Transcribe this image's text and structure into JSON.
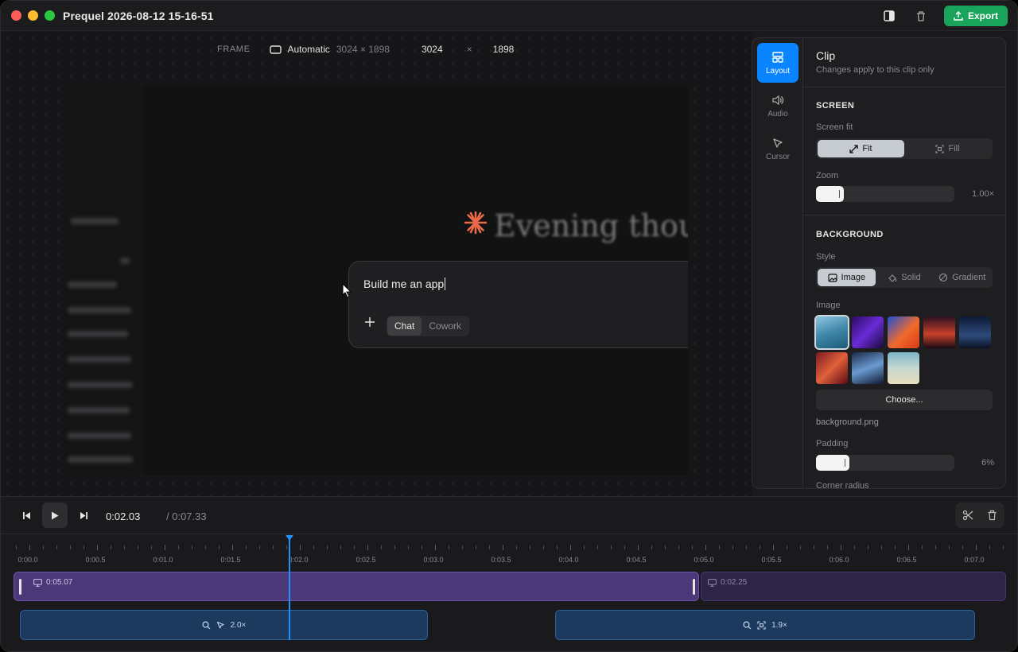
{
  "window": {
    "title": "Prequel 2026-08-12 15-16-51",
    "export_label": "Export"
  },
  "frame": {
    "label": "FRAME",
    "mode": "Automatic",
    "dims": "3024 × 1898",
    "width": "3024",
    "times": "×",
    "height": "1898"
  },
  "preview": {
    "heading": "Evening though",
    "prompt": "Build me an app",
    "mode_tabs": [
      "Chat",
      "Cowork"
    ],
    "active_mode": "Chat"
  },
  "panel": {
    "tabs": [
      {
        "label": "Layout",
        "icon": "layout-icon",
        "active": true
      },
      {
        "label": "Audio",
        "icon": "speaker-icon",
        "active": false
      },
      {
        "label": "Cursor",
        "icon": "cursor-icon",
        "active": false
      }
    ],
    "clip_title": "Clip",
    "clip_subtitle": "Changes apply to this clip only",
    "screen": {
      "title": "SCREEN",
      "fit_label": "Screen fit",
      "fit_options": [
        "Fit",
        "Fill"
      ],
      "active_fit": "Fit",
      "zoom_label": "Zoom",
      "zoom_value": "1.00×",
      "zoom_fraction": 0.2
    },
    "background": {
      "title": "BACKGROUND",
      "style_label": "Style",
      "style_options": [
        "Image",
        "Solid",
        "Gradient"
      ],
      "active_style": "Image",
      "image_label": "Image",
      "choose_label": "Choose...",
      "filename": "background.png",
      "padding_label": "Padding",
      "padding_value": "6%",
      "padding_fraction": 0.24,
      "corner_label": "Corner radius"
    }
  },
  "transport": {
    "current": "0:02.03",
    "total": "/ 0:07.33"
  },
  "timeline": {
    "ticks": [
      "0:00.0",
      "0:00.5",
      "0:01.0",
      "0:01.5",
      "0:02.0",
      "0:02.5",
      "0:03.0",
      "0:03.5",
      "0:04.0",
      "0:04.5",
      "0:05.0",
      "0:05.5",
      "0:06.0",
      "0:06.5",
      "0:07.0"
    ],
    "clip1_duration": "0:05.07",
    "clip2_duration": "0:02.25",
    "zoom1": "2.0×",
    "zoom2": "1.9×"
  },
  "colors": {
    "accent": "#0a84ff",
    "export": "#1aa35a",
    "clip": "#4a3878",
    "zoom": "#1b3a5e"
  }
}
